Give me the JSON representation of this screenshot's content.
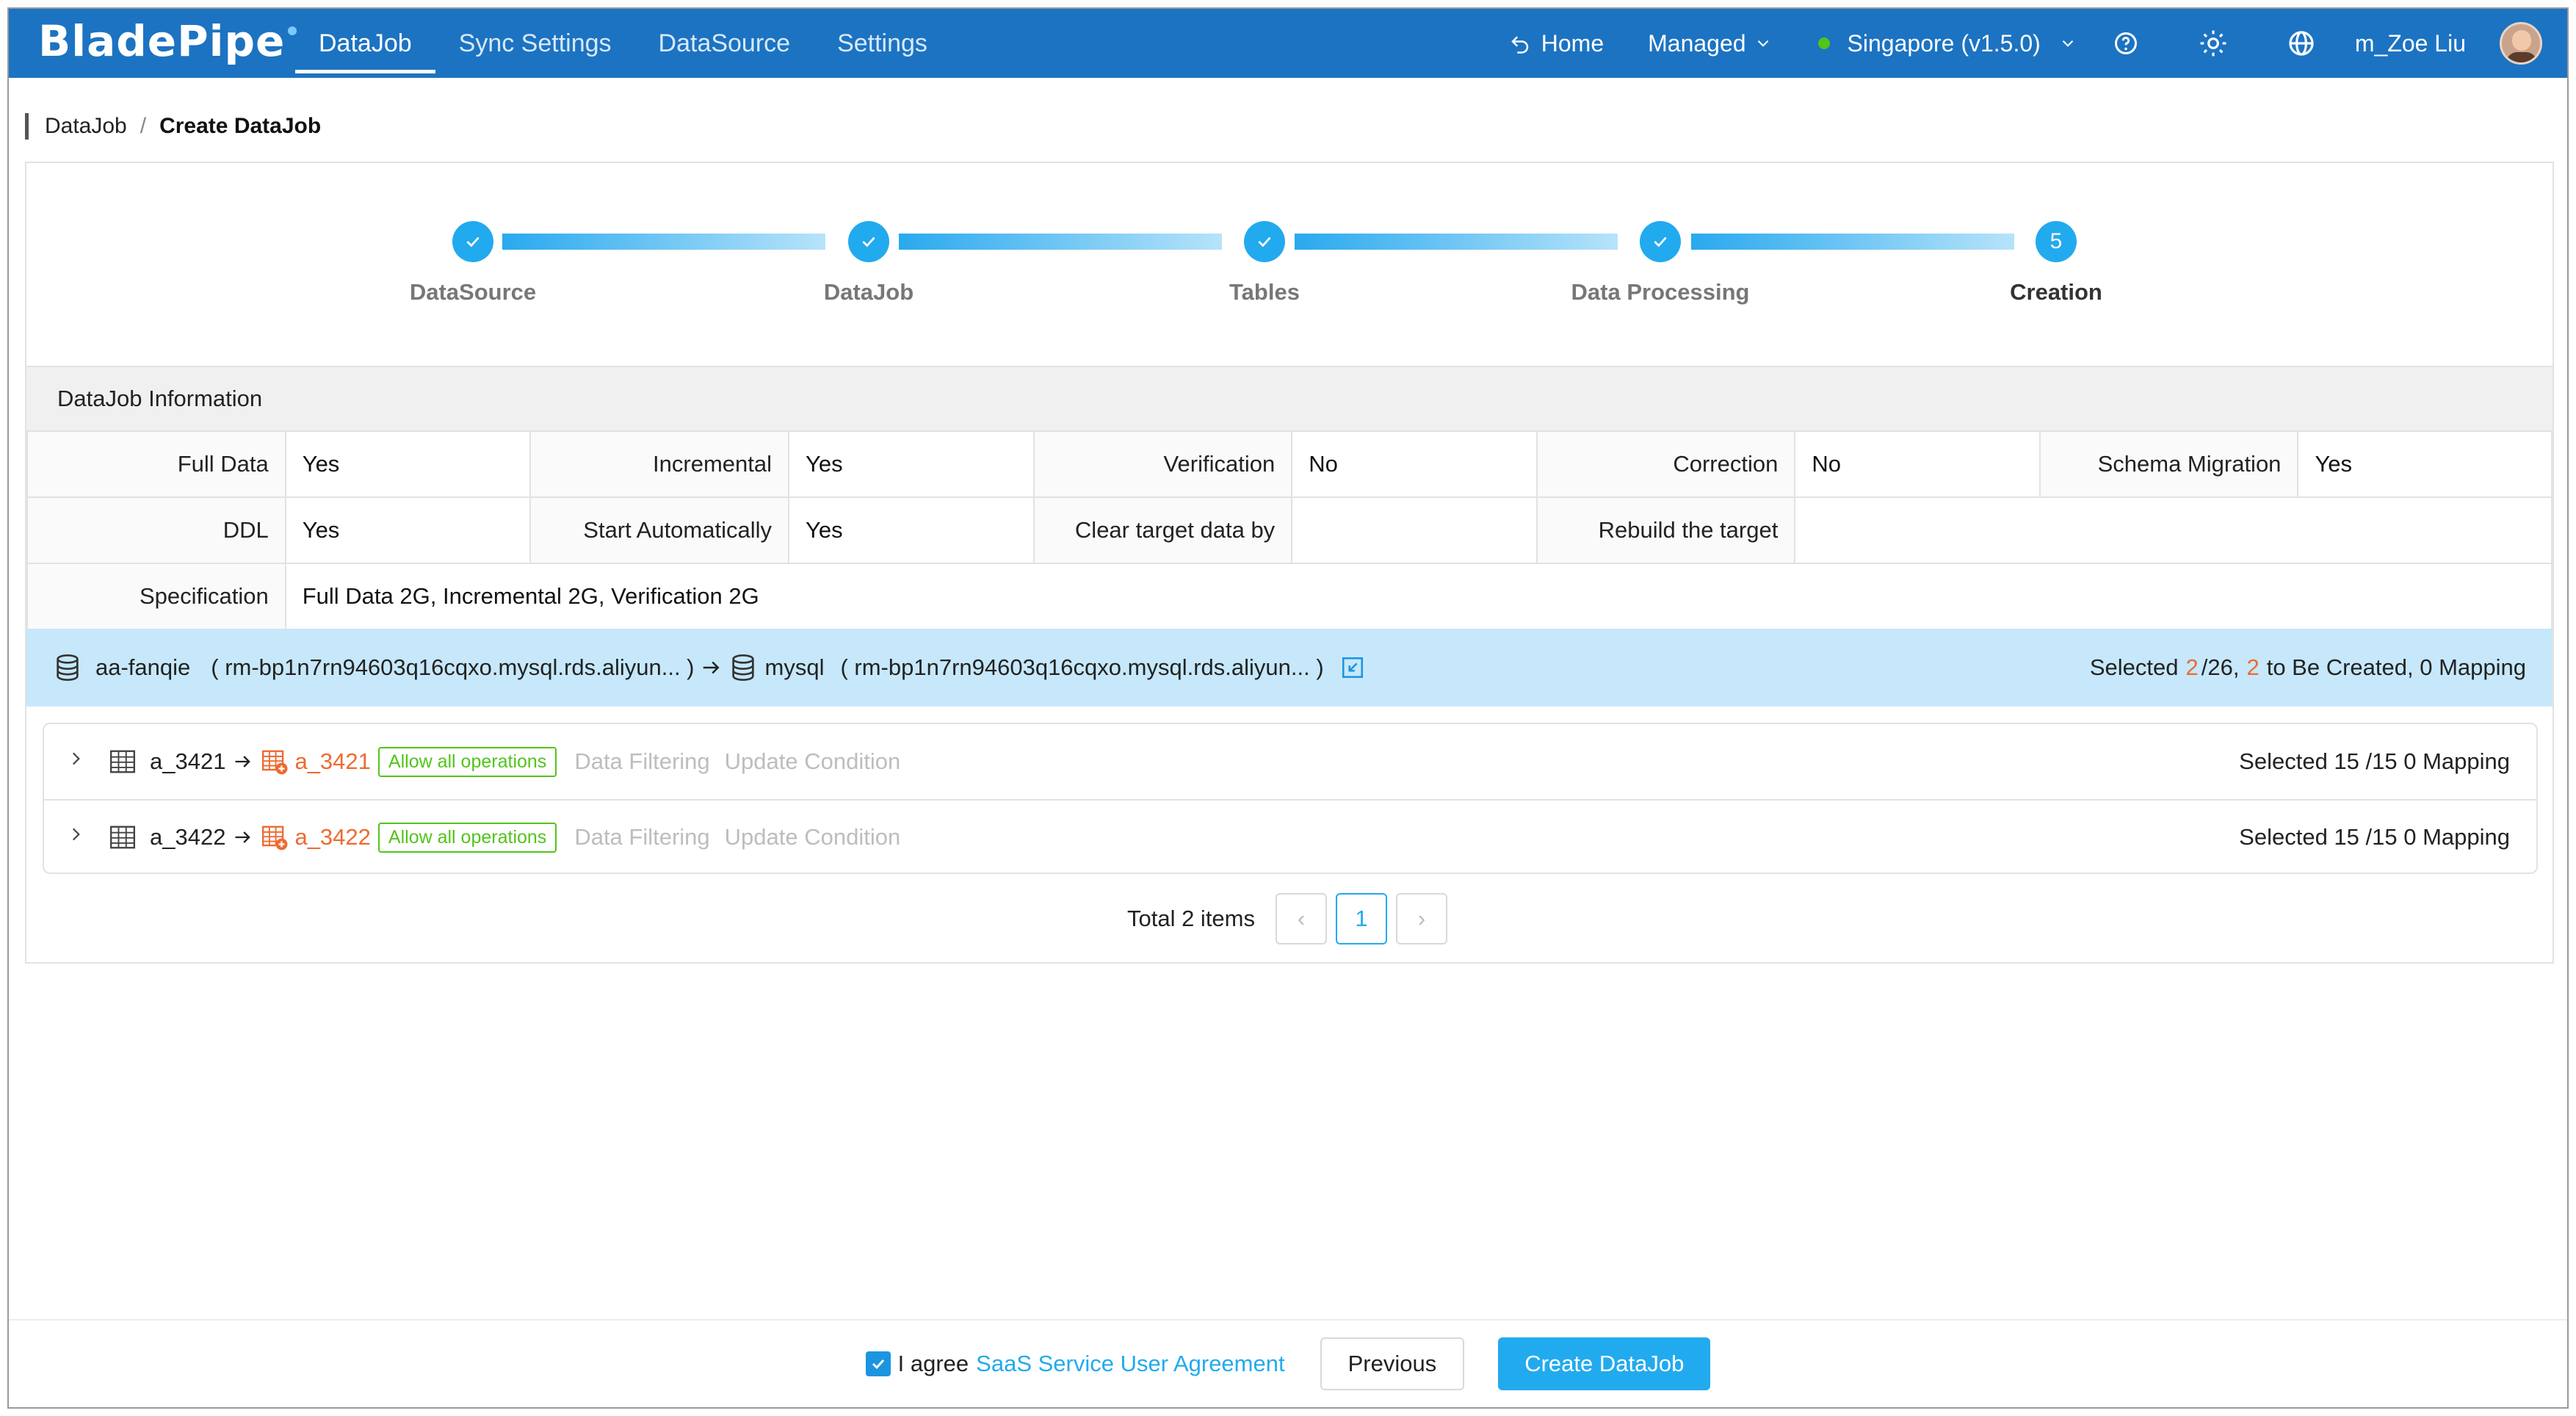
{
  "app": {
    "logo": "BladePipe"
  },
  "nav": {
    "items": [
      "DataJob",
      "Sync Settings",
      "DataSource",
      "Settings"
    ],
    "active": "DataJob"
  },
  "top_right": {
    "home": "Home",
    "mode": "Managed",
    "region": "Singapore (v1.5.0)",
    "user": "m_Zoe Liu"
  },
  "breadcrumb": {
    "parent": "DataJob",
    "sep": "/",
    "current": "Create DataJob"
  },
  "steps": [
    {
      "label": "DataSource",
      "state": "done"
    },
    {
      "label": "DataJob",
      "state": "done"
    },
    {
      "label": "Tables",
      "state": "done"
    },
    {
      "label": "Data Processing",
      "state": "done"
    },
    {
      "label": "Creation",
      "state": "current",
      "number": "5"
    }
  ],
  "info": {
    "title": "DataJob Information",
    "rows": [
      [
        [
          "Full Data",
          "Yes"
        ],
        [
          "Incremental",
          "Yes"
        ],
        [
          "Verification",
          "No"
        ],
        [
          "Correction",
          "No"
        ],
        [
          "Schema Migration",
          "Yes"
        ]
      ],
      [
        [
          "DDL",
          "Yes"
        ],
        [
          "Start Automatically",
          "Yes"
        ],
        [
          "Clear target data by",
          ""
        ],
        [
          "Rebuild the target",
          ""
        ]
      ],
      [
        [
          "Specification",
          "Full Data 2G, Incremental 2G, Verification 2G"
        ]
      ]
    ]
  },
  "mapping": {
    "source_name": "aa-fanqie",
    "source_host": "( rm-bp1n7rn94603q16cqxo.mysql.rds.aliyun... )",
    "target_name": "mysql",
    "target_host": "( rm-bp1n7rn94603q16cqxo.mysql.rds.aliyun... )",
    "summary_prefix": "Selected",
    "selected": "2",
    "total": "/26,",
    "to_create": "2",
    "summary_suffix": "to Be Created, 0 Mapping"
  },
  "tables": [
    {
      "source": "a_3421",
      "target": "a_3421",
      "tag": "Allow all operations",
      "filter": "Data Filtering",
      "update": "Update Condition",
      "summary": "Selected 15 /15 0 Mapping"
    },
    {
      "source": "a_3422",
      "target": "a_3422",
      "tag": "Allow all operations",
      "filter": "Data Filtering",
      "update": "Update Condition",
      "summary": "Selected 15 /15 0 Mapping"
    }
  ],
  "pagination": {
    "total": "Total 2 items",
    "current": "1",
    "prev": "‹",
    "next": "›"
  },
  "footer": {
    "agree": "I agree",
    "agreement": "SaaS Service User Agreement",
    "previous": "Previous",
    "create": "Create DataJob"
  },
  "colors": {
    "nav": "#1c73c2",
    "accent": "#22aaee",
    "orange": "#ee6a31",
    "green": "#52c41a"
  }
}
